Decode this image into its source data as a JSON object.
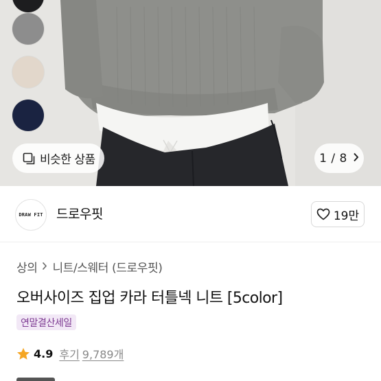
{
  "hero": {
    "swatches": [
      {
        "name": "black",
        "color": "#1d1d1f"
      },
      {
        "name": "gray",
        "color": "#8d8d8d"
      },
      {
        "name": "beige",
        "color": "#e2d7cb"
      },
      {
        "name": "navy",
        "color": "#1a2341"
      }
    ],
    "similar_label": "비슷한 상품",
    "pager_text": "1 / 8"
  },
  "brand": {
    "logo_text": "DRAW FIT",
    "name": "드로우핏",
    "likes": "19만"
  },
  "product": {
    "breadcrumb": [
      "상의",
      "니트/스웨터 (드로우핏)"
    ],
    "title": "오버사이즈 집업 카라 터틀넥 니트 [5color]",
    "badge": "연말결산세일",
    "rating": "4.9",
    "review_label": "후기",
    "review_count": "9,789개"
  },
  "colors": {
    "sweater": "#8e8f8b",
    "shirt": "#f5f5f3",
    "pants": "#26272b",
    "background": "#e6e5e2",
    "star": "#f5a623",
    "badge_bg": "#f2e8f6",
    "badge_text": "#7d3a92"
  }
}
